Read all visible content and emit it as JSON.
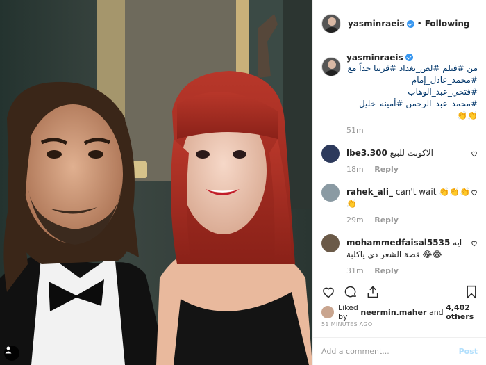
{
  "header": {
    "username": "yasminraeis",
    "follow_status": "Following"
  },
  "caption": {
    "username": "yasminraeis",
    "text": "من #فيلم #لص_بغداد #قريبا جداً مع #محمد_عادل_إمام #فتحي_عبد_الوهاب #محمد_عبد_الرحمن #أمينه_خليل 👏👏",
    "time": "51m"
  },
  "comments": [
    {
      "username": "lbe3.300",
      "text": "الاكونت للبيع",
      "time": "18m",
      "reply": "Reply",
      "avatar_color": "#2d3a5c"
    },
    {
      "username": "rahek_ali_",
      "text": "can't wait 👏👏👏👏",
      "time": "29m",
      "reply": "Reply",
      "avatar_color": "#8a9aa3"
    },
    {
      "username": "mohammedfaisal5535",
      "text": "ايه قصة الشعر دي ياكلبة 😂😂",
      "time": "31m",
      "reply": "Reply",
      "avatar_color": "#6b5a48"
    }
  ],
  "likes": {
    "prefix": "Liked by",
    "user": "neermin.maher",
    "joiner": "and",
    "others": "4,402 others"
  },
  "time_ago": "51 MINUTES AGO",
  "add_comment": {
    "placeholder": "Add a comment...",
    "post_label": "Post"
  },
  "icons": [
    "verified-badge-icon",
    "heart-icon",
    "comment-icon",
    "share-icon",
    "bookmark-icon",
    "user-tag-icon"
  ]
}
